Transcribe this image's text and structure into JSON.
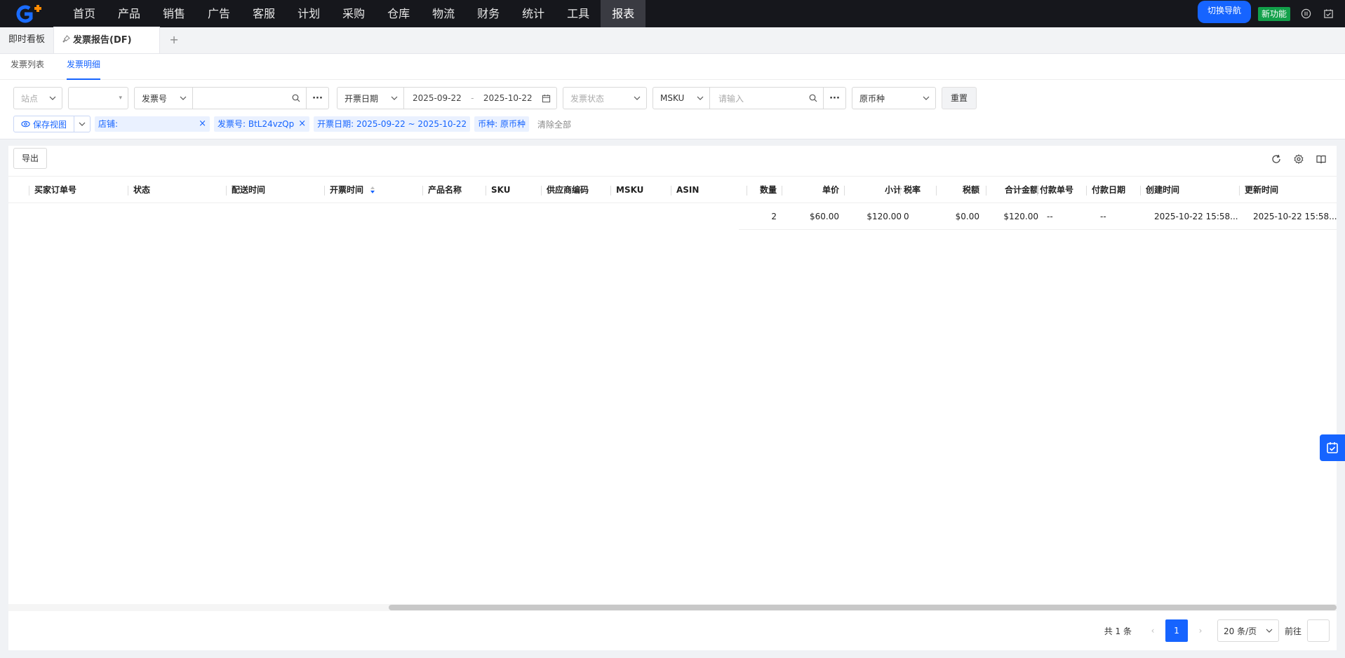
{
  "nav": {
    "items": [
      "首页",
      "产品",
      "销售",
      "广告",
      "客服",
      "计划",
      "采购",
      "仓库",
      "物流",
      "财务",
      "统计",
      "工具",
      "报表"
    ],
    "active_index": 12,
    "switch_nav": "切换导航",
    "new_feature": "新功能"
  },
  "page_tabs": {
    "dashboard": "即时看板",
    "current": "发票报告(DF)",
    "add": "+"
  },
  "sub_tabs": [
    "发票列表",
    "发票明细"
  ],
  "sub_tab_active": 1,
  "filters": {
    "site_placeholder": "站点",
    "invoice_no_select": "发票号",
    "date_type": "开票日期",
    "date_start": "2025-09-22",
    "date_sep": "-",
    "date_end": "2025-10-22",
    "invoice_status_placeholder": "发票状态",
    "msku_select": "MSKU",
    "msku_placeholder": "请输入",
    "currency": "原币种",
    "reset": "重置",
    "more": "···"
  },
  "view": {
    "save_view": "保存视图"
  },
  "tags": [
    {
      "label": "店铺:"
    },
    {
      "label": "发票号:  BtL24vzQp"
    },
    {
      "label": "开票日期:  2025-09-22 ~ 2025-10-22"
    },
    {
      "label": "币种:  原币种"
    }
  ],
  "clear_all": "清除全部",
  "export": "导出",
  "columns": [
    "买家订单号",
    "状态",
    "配送时间",
    "开票时间",
    "产品名称",
    "SKU",
    "供应商编码",
    "MSKU",
    "ASIN",
    "数量",
    "单价",
    "小计",
    "税率",
    "税额",
    "合计金额",
    "付款单号",
    "付款日期",
    "创建时间",
    "更新时间"
  ],
  "row": {
    "quantity": "2",
    "unit_price": "$60.00",
    "subtotal": "$120.00",
    "tax_rate": "0",
    "tax_amount": "$0.00",
    "total": "$120.00",
    "payment_no": "--",
    "payment_date": "--",
    "created": "2025-10-22 15:58...",
    "updated": "2025-10-22 15:58..."
  },
  "pager": {
    "total": "共 1 条",
    "current_page": "1",
    "page_size": "20 条/页",
    "goto": "前往"
  },
  "colors": {
    "accent": "#1664ff",
    "nav_bg": "#16171c",
    "new_badge": "#12a04a"
  }
}
